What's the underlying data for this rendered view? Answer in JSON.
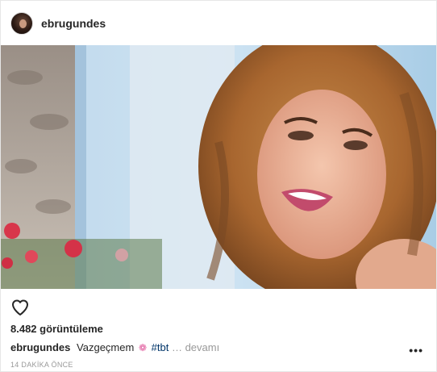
{
  "header": {
    "username": "ebrugundes"
  },
  "post": {
    "views": "8.482 görüntüleme",
    "caption": {
      "username": "ebrugundes",
      "text": "Vazgeçmem",
      "emoji": "❁",
      "hashtag": "#tbt",
      "more_label": "… devamı"
    },
    "more_options": "•••",
    "timestamp": "14 DAKİKA ÖNCE"
  },
  "icons": {
    "like": "heart-icon",
    "options": "ellipsis-icon",
    "avatar": "profile-avatar"
  },
  "colors": {
    "text": "#262626",
    "muted": "#999999",
    "hashtag": "#003569",
    "emoji": "#e05a9c"
  }
}
